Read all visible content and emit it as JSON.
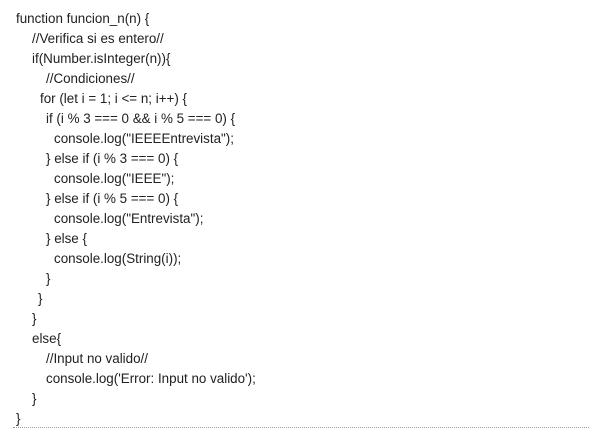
{
  "code": {
    "lines": [
      {
        "indent": 0,
        "text": "function funcion_n(n) {"
      },
      {
        "indent": 16,
        "text": "//Verifica si es entero//"
      },
      {
        "indent": 16,
        "text": "if(Number.isInteger(n)){"
      },
      {
        "indent": 30,
        "text": "//Condiciones//"
      },
      {
        "indent": 24,
        "text": "for (let i = 1; i <= n; i++) {"
      },
      {
        "indent": 30,
        "text": "if (i % 3 === 0 && i % 5 === 0) {"
      },
      {
        "indent": 38,
        "text": "console.log(\"IEEEEntrevista\");"
      },
      {
        "indent": 30,
        "text": "} else if (i % 3 === 0) {"
      },
      {
        "indent": 38,
        "text": "console.log(\"IEEE\");"
      },
      {
        "indent": 30,
        "text": "} else if (i % 5 === 0) {"
      },
      {
        "indent": 38,
        "text": "console.log(\"Entrevista\");"
      },
      {
        "indent": 30,
        "text": "} else {"
      },
      {
        "indent": 38,
        "text": "console.log(String(i));"
      },
      {
        "indent": 30,
        "text": "}"
      },
      {
        "indent": 22,
        "text": "}"
      },
      {
        "indent": 16,
        "text": "}"
      },
      {
        "indent": 16,
        "text": "else{"
      },
      {
        "indent": 30,
        "text": "//Input no valido//"
      },
      {
        "indent": 30,
        "text": "console.log('Error: Input no valido');"
      },
      {
        "indent": 16,
        "text": "}"
      },
      {
        "indent": 0,
        "text": "}"
      }
    ]
  }
}
